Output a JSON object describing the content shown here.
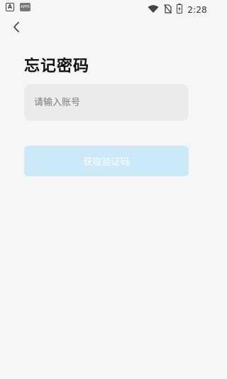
{
  "status_bar": {
    "left_icon_a": "A",
    "left_icon_app": "APPS",
    "time": "2:28",
    "icons": [
      "wifi-icon",
      "no-sim-icon",
      "battery-charging-icon"
    ]
  },
  "header": {
    "back_icon": "chevron-left-icon",
    "title": "忘记密码"
  },
  "form": {
    "account_placeholder": "请输入账号",
    "account_value": "",
    "get_code_label": "获取验证码"
  },
  "colors": {
    "background": "#f6f6f7",
    "input_bg": "#ebebec",
    "button_disabled_bg": "#cbe9f9",
    "button_text": "#ffffff"
  }
}
